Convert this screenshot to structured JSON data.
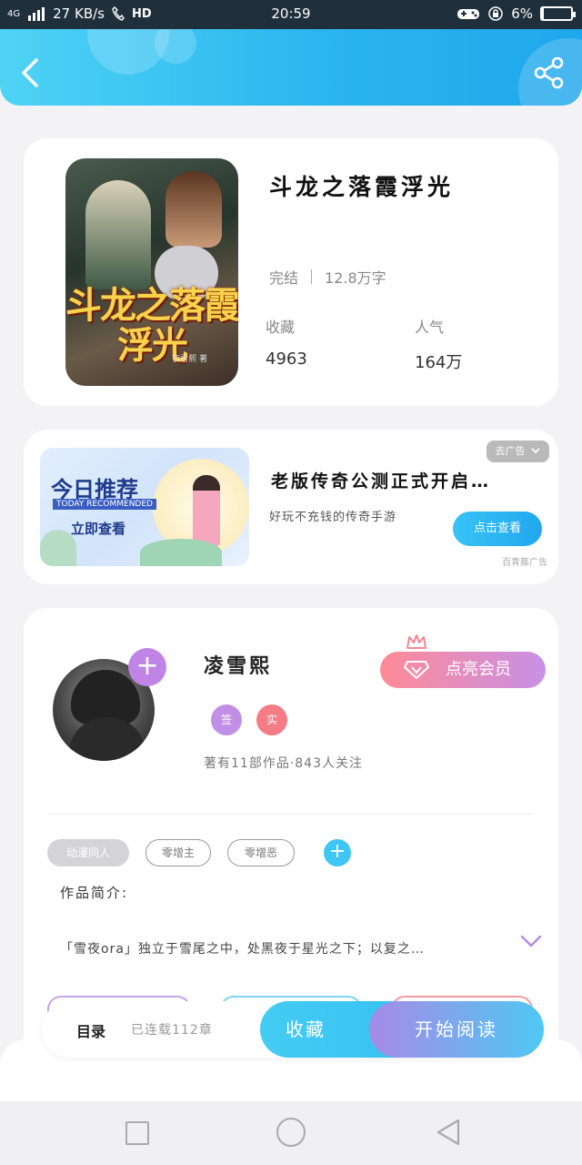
{
  "status_bar": {
    "network": "4G",
    "speed": "27 KB/s",
    "hd": "HD",
    "time": "20:59",
    "battery_percent": "6%",
    "battery_level": 0.06
  },
  "book": {
    "cover_title": "斗龙之落霞浮光",
    "cover_author": "夜雪熙 著",
    "title": "斗龙之落霞浮光",
    "status": "完结",
    "word_count": "12.8万字",
    "favorites_label": "收藏",
    "favorites_value": "4963",
    "popularity_label": "人气",
    "popularity_value": "164万"
  },
  "ad": {
    "image_title": "今日推荐",
    "image_subtitle": "TODAY RECOMMENDED",
    "image_cta": "立即查看",
    "close_label": "去广告",
    "title": "老版传奇公测正式开启…",
    "description": "好玩不充钱的传奇手游",
    "button_label": "点击查看",
    "source": "百青藤广告"
  },
  "author": {
    "follow_symbol": "+",
    "name": "凌雪熙",
    "vip_label": "点亮会员",
    "badge_1": "签",
    "badge_2": "实",
    "stats": "著有11部作品·843人关注",
    "tags": [
      "动漫同人",
      "零增主",
      "零增恶"
    ],
    "add_tag_symbol": "+",
    "intro_label": "作品简介:",
    "intro_text": "「雪夜ora」独立于雪尾之中，处黑夜于星光之下；以复之…"
  },
  "action_bar": {
    "toc_label": "目录",
    "toc_status": "已连载112章",
    "collect_label": "收藏",
    "read_label": "开始阅读"
  },
  "colors": {
    "header_start": "#4fd3f5",
    "header_end": "#1fa7ec",
    "accent_blue": "#36c0f2",
    "accent_purple": "#c084e4",
    "vip_pink": "#ff8a96"
  }
}
